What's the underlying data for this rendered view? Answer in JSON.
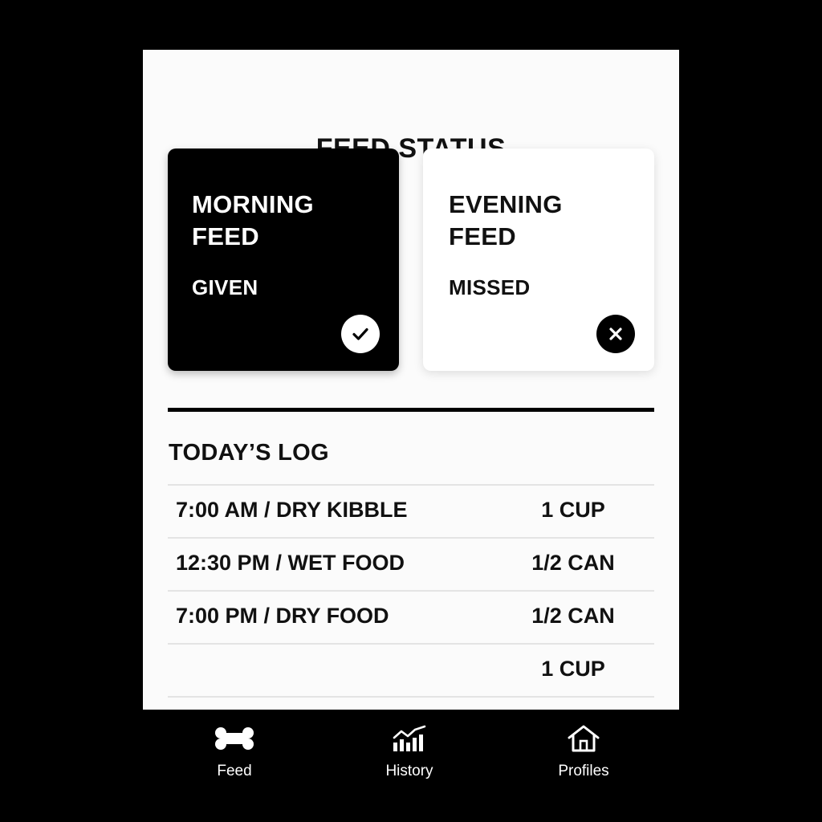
{
  "header": {
    "title": "FEED STATUS"
  },
  "status_cards": [
    {
      "title": "MORNING FEED",
      "status": "GIVEN",
      "icon": "check-icon"
    },
    {
      "title": "EVENING FEED",
      "status": "MISSED",
      "icon": "close-icon"
    }
  ],
  "log": {
    "heading": "TODAY’S LOG",
    "rows": [
      {
        "description": "7:00 AM / DRY KIBBLE",
        "amount": "1 CUP"
      },
      {
        "description": "12:30 PM / WET FOOD",
        "amount": "1/2 CAN"
      },
      {
        "description": "7:00 PM / DRY FOOD",
        "amount": "1/2 CAN"
      },
      {
        "description": "",
        "amount": "1 CUP"
      }
    ]
  },
  "nav": {
    "items": [
      {
        "label": "Feed",
        "icon": "bone-icon"
      },
      {
        "label": "History",
        "icon": "chart-icon"
      },
      {
        "label": "Profiles",
        "icon": "home-icon"
      }
    ]
  },
  "colors": {
    "background": "#000000",
    "surface": "#fbfbfb",
    "accent": "#000000"
  }
}
